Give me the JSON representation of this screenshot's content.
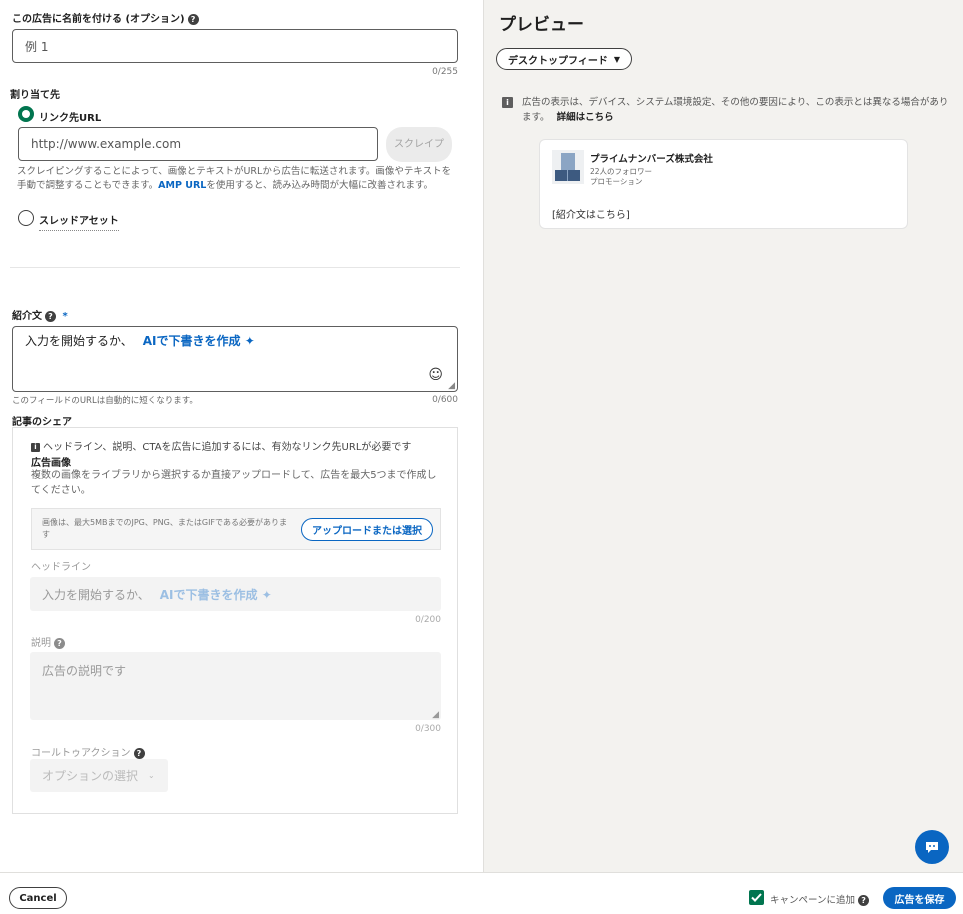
{
  "form": {
    "ad_name": {
      "label": "この広告に名前を付ける (オプション)",
      "placeholder": "例 1",
      "counter": "0/255"
    },
    "destination": {
      "label": "割り当て先",
      "option_url_label": "リンク先URL",
      "url_placeholder": "http://www.example.com",
      "scrape_button": "スクレイプ",
      "help_part1": "スクレイピングすることによって、画像とテキストがURLから広告に転送されます。画像やテキストを手動で調整することもできます。",
      "help_link": "AMP URL",
      "help_part2": "を使用すると、読み込み時間が大幅に改善されます。",
      "option_thread_label": "スレッドアセット"
    },
    "intro": {
      "label": "紹介文",
      "required_mark": "*",
      "placeholder": "入力を開始するか、",
      "ai_link": "AIで下書きを作成 ✦",
      "help": "このフィールドのURLは自動的に短くなります。",
      "counter": "0/600"
    },
    "article_share": {
      "label": "記事のシェア",
      "info": "ヘッドライン、説明、CTAを広告に追加するには、有効なリンク先URLが必要です",
      "images_label": "広告画像",
      "images_help": "複数の画像をライブラリから選択するか直接アップロードして、広告を最大5つまで作成してください。",
      "upload_help": "画像は、最大5MBまでのJPG、PNG、またはGIFである必要があります",
      "upload_button": "アップロードまたは選択",
      "headline_label": "ヘッドライン",
      "headline_placeholder": "入力を開始するか、",
      "headline_ai_link": "AIで下書きを作成 ✦",
      "headline_counter": "0/200",
      "description_label": "説明",
      "description_placeholder": "広告の説明です",
      "description_counter": "0/300",
      "cta_label": "コールトゥアクション",
      "cta_placeholder": "オプションの選択"
    }
  },
  "preview": {
    "title": "プレビュー",
    "feed_select": "デスクトップフィード",
    "notice": "広告の表示は、デバイス、システム環境設定、その他の要因により、この表示とは異なる場合があります。",
    "notice_link": "詳細はこちら",
    "card": {
      "company": "プライムナンバーズ株式会社",
      "followers": "22人のフォロワー",
      "promoted": "プロモーション",
      "intro_placeholder": "[紹介文はこちら]"
    }
  },
  "footer": {
    "cancel": "Cancel",
    "add_to_campaign": "キャンペーンに追加",
    "save": "広告を保存"
  },
  "colors": {
    "accent": "#0a66c2",
    "success": "#01754f",
    "preview_bg": "#f3f2ef"
  }
}
